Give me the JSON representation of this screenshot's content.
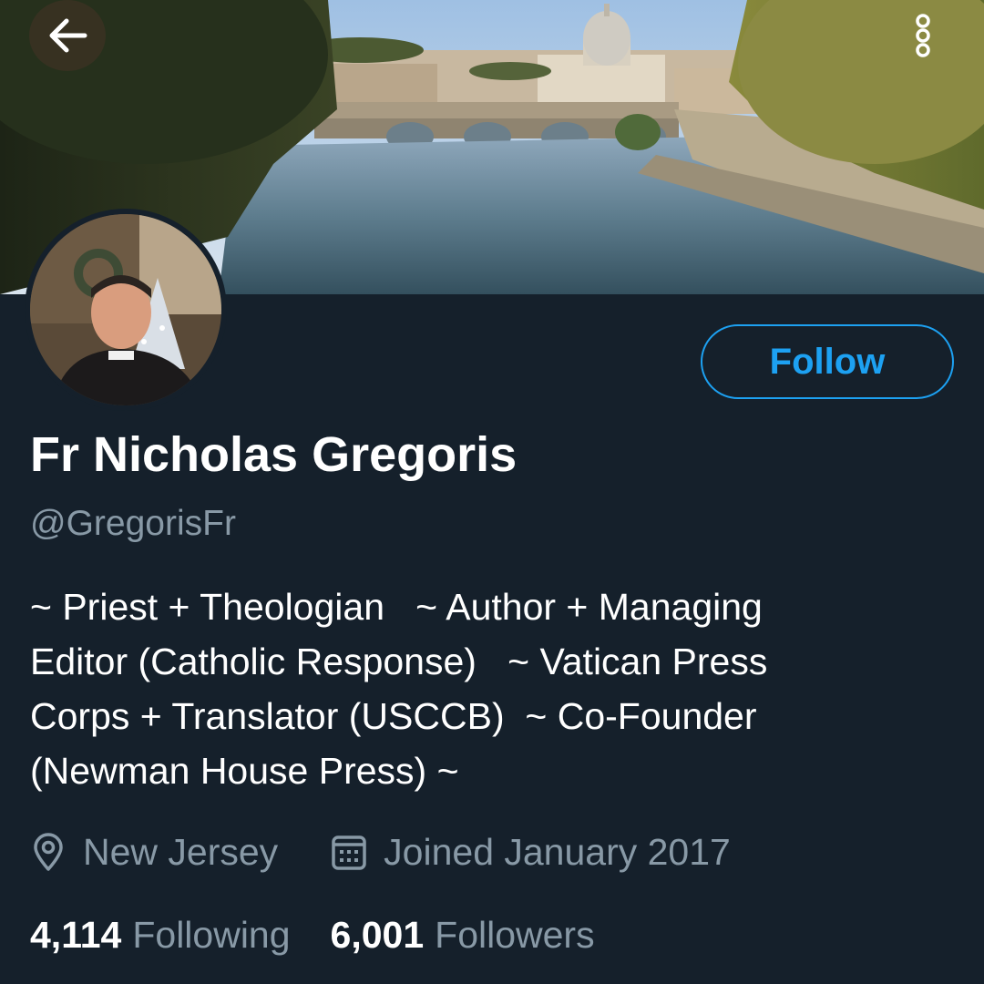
{
  "header": {
    "back_icon": "arrow-left-icon",
    "menu_icon": "vertical-dots-icon"
  },
  "profile": {
    "name": "Fr Nicholas Gregoris",
    "handle": "@GregorisFr",
    "bio_lines": [
      "~ Priest + Theologian   ~ Author + Managing",
      "Editor (Catholic Response)   ~ Vatican Press",
      "Corps + Translator (USCCB)  ~ Co-Founder",
      "(Newman House Press) ~"
    ],
    "location": "New Jersey",
    "location_icon": "location-pin-icon",
    "joined": "Joined January 2017",
    "joined_icon": "calendar-icon",
    "following_count": "4,114",
    "following_label": "Following",
    "followers_count": "6,001",
    "followers_label": "Followers"
  },
  "actions": {
    "follow_label": "Follow"
  },
  "colors": {
    "background": "#15202b",
    "accent": "#1da1f2",
    "secondary_text": "#8899a6",
    "primary_text": "#ffffff"
  }
}
